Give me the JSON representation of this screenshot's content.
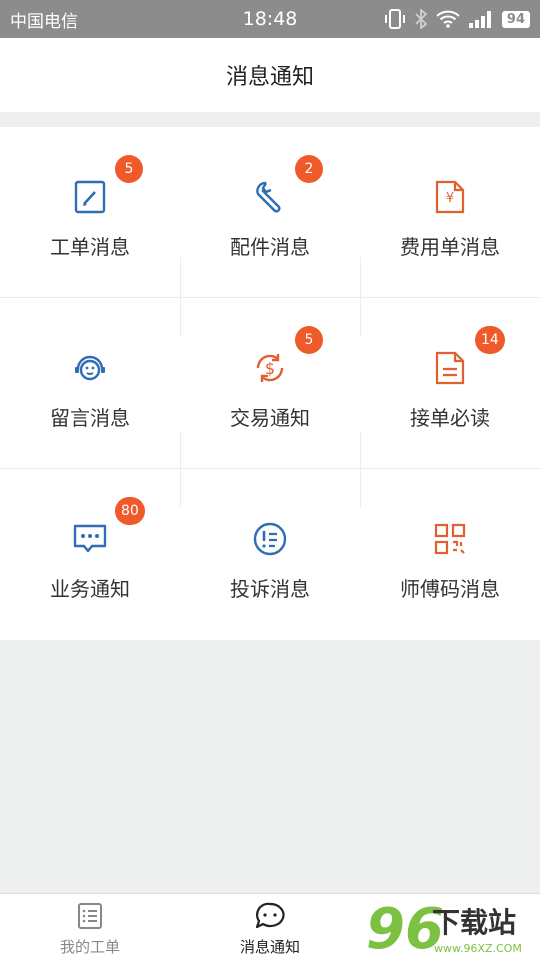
{
  "statusbar": {
    "carrier": "中国电信",
    "time": "18:48",
    "battery": "94",
    "icons": [
      "vibrate-icon",
      "bluetooth-icon",
      "wifi-icon",
      "signal-icon",
      "battery-icon"
    ]
  },
  "header": {
    "title": "消息通知"
  },
  "grid": {
    "items": [
      {
        "label": "工单消息",
        "badge": "5",
        "icon": "edit-icon",
        "color": "#2f6db5"
      },
      {
        "label": "配件消息",
        "badge": "2",
        "icon": "wrench-icon",
        "color": "#2f6db5"
      },
      {
        "label": "费用单消息",
        "badge": "",
        "icon": "yen-document-icon",
        "color": "#e0612f"
      },
      {
        "label": "留言消息",
        "badge": "",
        "icon": "customer-service-icon",
        "color": "#2f6db5"
      },
      {
        "label": "交易通知",
        "badge": "5",
        "icon": "dollar-cycle-icon",
        "color": "#e0612f"
      },
      {
        "label": "接单必读",
        "badge": "14",
        "icon": "document-icon",
        "color": "#e0612f"
      },
      {
        "label": "业务通知",
        "badge": "80",
        "icon": "chat-icon",
        "color": "#2f6db5"
      },
      {
        "label": "投诉消息",
        "badge": "",
        "icon": "complaint-icon",
        "color": "#2f6db5"
      },
      {
        "label": "师傅码消息",
        "badge": "",
        "icon": "qr-code-icon",
        "color": "#e0612f"
      }
    ]
  },
  "bottomnav": {
    "items": [
      {
        "label": "我的工单",
        "icon": "list-icon",
        "active": false
      },
      {
        "label": "消息通知",
        "icon": "message-icon",
        "active": true
      }
    ]
  },
  "watermark": {
    "number": "96",
    "text": "下载站",
    "url": "www.96XZ.COM"
  },
  "colors": {
    "badge": "#f0592a",
    "blue": "#2f6db5",
    "orange": "#e0612f",
    "background": "#eef0f0"
  }
}
